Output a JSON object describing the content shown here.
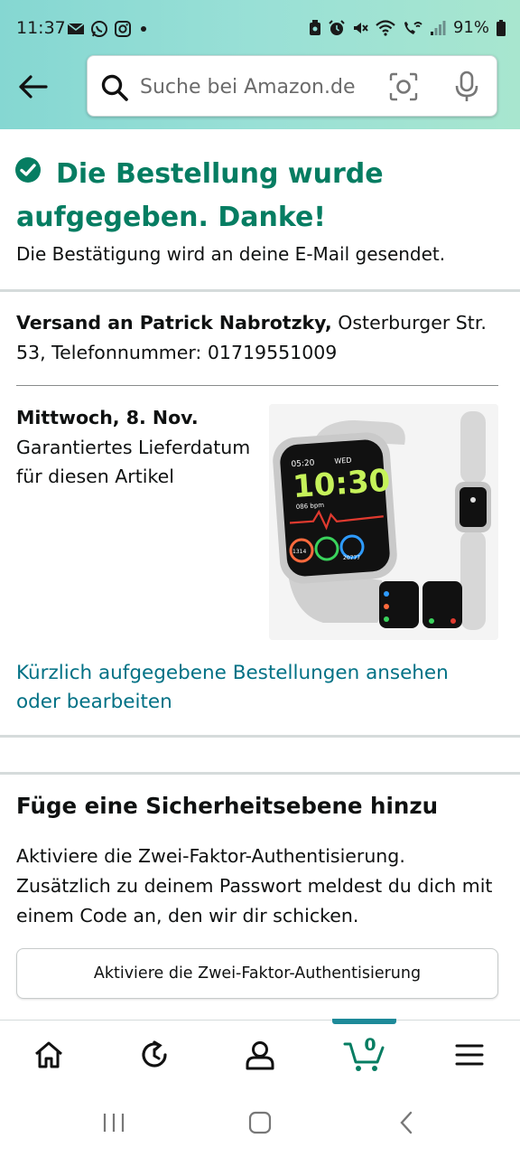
{
  "status_bar": {
    "time": "11:37",
    "battery": "91%",
    "left_icons": [
      "mail-icon",
      "whatsapp-icon",
      "instagram-icon",
      "dot-icon"
    ],
    "right_icons": [
      "nfc-icon",
      "alarm-icon",
      "mute-icon",
      "wifi-icon",
      "wifi-call-icon",
      "signal-icon",
      "battery-icon"
    ]
  },
  "header": {
    "search_placeholder": "Suche bei Amazon.de"
  },
  "confirmation": {
    "title_line1": "Die Bestellung wurde",
    "title_line2": "aufgegeben. Danke!",
    "subtitle": "Die Bestätigung wird an deine E-Mail gesendet."
  },
  "shipping": {
    "label": "Versand an Patrick Nabrotzky,",
    "address": " Osterburger Str. 53, Telefonnummer: 01719551009"
  },
  "delivery": {
    "date": "Mittwoch, 8. Nov.",
    "note": "Garantiertes Lieferdatum für diesen Artikel"
  },
  "product_image": {
    "watch_time": "10:30",
    "watch_top_time": "05:20",
    "watch_day": "WED",
    "watch_bpm": "086 bpm",
    "watch_steps": "1314",
    "watch_calories": "20777"
  },
  "orders_link": "Kürzlich aufgegebene Bestellungen ansehen oder bearbeiten",
  "security": {
    "title": "Füge eine Sicherheitsebene hinzu",
    "text": "Aktiviere die Zwei-Faktor-Authentisierung. Zusätzlich zu deinem Passwort meldest du dich mit einem Code an, den wir dir schicken.",
    "button": "Aktiviere die Zwei-Faktor-Authentisierung"
  },
  "bottom_nav": {
    "cart_count": "0",
    "items": [
      "home-icon",
      "refresh-icon",
      "account-icon",
      "cart-icon",
      "menu-icon"
    ],
    "active": "cart"
  },
  "colors": {
    "success_green": "#067d62",
    "link_teal": "#007185",
    "header_gradient_start": "#85d7d2",
    "header_gradient_end": "#a8e6cf",
    "active_tab": "#1d8a99"
  }
}
